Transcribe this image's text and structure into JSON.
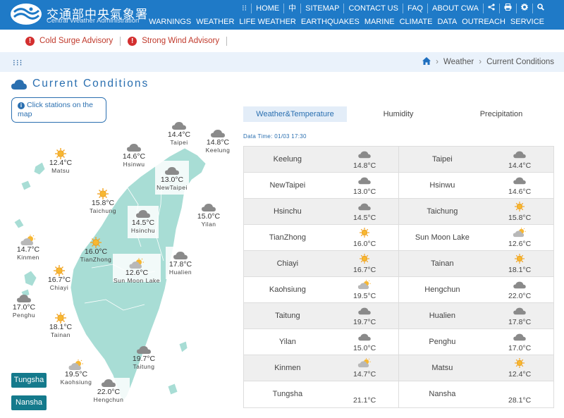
{
  "header": {
    "brand_zh": "交通部中央氣象署",
    "brand_en": "Central Weather Administration",
    "top_links": [
      "HOME",
      "中",
      "SITEMAP",
      "CONTACT US",
      "FAQ",
      "ABOUT CWA"
    ],
    "main_nav": [
      "WARNINGS",
      "WEATHER",
      "LIFE WEATHER",
      "EARTHQUAKES",
      "MARINE",
      "CLIMATE",
      "DATA",
      "OUTREACH",
      "SERVICE"
    ]
  },
  "advisories": [
    "Cold Surge Advisory",
    "Strong Wind Advisory"
  ],
  "breadcrumb": {
    "sep": "›",
    "level1": "Weather",
    "level2": "Current Conditions"
  },
  "page_title": "Current Conditions",
  "map_hint": "Click stations on the map",
  "map_stations": [
    {
      "name": "Taipei",
      "temp": "14.4°C",
      "icon": "cloudy-icon"
    },
    {
      "name": "Keelung",
      "temp": "14.8°C",
      "icon": "cloudy-icon"
    },
    {
      "name": "Hsinwu",
      "temp": "14.6°C",
      "icon": "cloudy-icon"
    },
    {
      "name": "Matsu",
      "temp": "12.4°C",
      "icon": "sunny-icon"
    },
    {
      "name": "NewTaipei",
      "temp": "13.0°C",
      "icon": "cloudy-icon"
    },
    {
      "name": "Taichung",
      "temp": "15.8°C",
      "icon": "sunny-icon"
    },
    {
      "name": "Hsinchu",
      "temp": "14.5°C",
      "icon": "cloudy-icon"
    },
    {
      "name": "Yilan",
      "temp": "15.0°C",
      "icon": "cloudy-icon"
    },
    {
      "name": "Kinmen",
      "temp": "14.7°C",
      "icon": "partly-cloudy-icon"
    },
    {
      "name": "TianZhong",
      "temp": "16.0°C",
      "icon": "sunny-icon"
    },
    {
      "name": "Sun Moon Lake",
      "temp": "12.6°C",
      "icon": "partly-cloudy-icon"
    },
    {
      "name": "Hualien",
      "temp": "17.8°C",
      "icon": "cloudy-icon"
    },
    {
      "name": "Chiayi",
      "temp": "16.7°C",
      "icon": "sunny-icon"
    },
    {
      "name": "Penghu",
      "temp": "17.0°C",
      "icon": "cloudy-icon"
    },
    {
      "name": "Tainan",
      "temp": "18.1°C",
      "icon": "sunny-icon"
    },
    {
      "name": "Taitung",
      "temp": "19.7°C",
      "icon": "cloudy-icon"
    },
    {
      "name": "Kaohsiung",
      "temp": "19.5°C",
      "icon": "partly-cloudy-icon"
    },
    {
      "name": "Hengchun",
      "temp": "22.0°C",
      "icon": "cloudy-icon"
    }
  ],
  "island_buttons": [
    "Tungsha",
    "Nansha"
  ],
  "tabs": [
    "Weather&Temperature",
    "Humidity",
    "Precipitation"
  ],
  "data_time": "Data Time: 01/03 17:30",
  "table_rows": [
    {
      "left": {
        "name": "Keelung",
        "temp": "14.8°C",
        "icon": "cloudy-icon"
      },
      "right": {
        "name": "Taipei",
        "temp": "14.4°C",
        "icon": "cloudy-icon"
      }
    },
    {
      "left": {
        "name": "NewTaipei",
        "temp": "13.0°C",
        "icon": "cloudy-icon"
      },
      "right": {
        "name": "Hsinwu",
        "temp": "14.6°C",
        "icon": "cloudy-icon"
      }
    },
    {
      "left": {
        "name": "Hsinchu",
        "temp": "14.5°C",
        "icon": "cloudy-icon"
      },
      "right": {
        "name": "Taichung",
        "temp": "15.8°C",
        "icon": "sunny-icon"
      }
    },
    {
      "left": {
        "name": "TianZhong",
        "temp": "16.0°C",
        "icon": "sunny-icon"
      },
      "right": {
        "name": "Sun Moon Lake",
        "temp": "12.6°C",
        "icon": "partly-cloudy-icon"
      }
    },
    {
      "left": {
        "name": "Chiayi",
        "temp": "16.7°C",
        "icon": "sunny-icon"
      },
      "right": {
        "name": "Tainan",
        "temp": "18.1°C",
        "icon": "sunny-icon"
      }
    },
    {
      "left": {
        "name": "Kaohsiung",
        "temp": "19.5°C",
        "icon": "partly-cloudy-icon"
      },
      "right": {
        "name": "Hengchun",
        "temp": "22.0°C",
        "icon": "cloudy-icon"
      }
    },
    {
      "left": {
        "name": "Taitung",
        "temp": "19.7°C",
        "icon": "cloudy-icon"
      },
      "right": {
        "name": "Hualien",
        "temp": "17.8°C",
        "icon": "cloudy-icon"
      }
    },
    {
      "left": {
        "name": "Yilan",
        "temp": "15.0°C",
        "icon": "cloudy-icon"
      },
      "right": {
        "name": "Penghu",
        "temp": "17.0°C",
        "icon": "cloudy-icon"
      }
    },
    {
      "left": {
        "name": "Kinmen",
        "temp": "14.7°C",
        "icon": "partly-cloudy-icon"
      },
      "right": {
        "name": "Matsu",
        "temp": "12.4°C",
        "icon": "sunny-icon"
      }
    },
    {
      "left": {
        "name": "Tungsha",
        "temp": "21.1°C",
        "icon": ""
      },
      "right": {
        "name": "Nansha",
        "temp": "28.1°C",
        "icon": ""
      }
    }
  ],
  "colors": {
    "header": "#1f7ac7",
    "island": "#a8ddd5",
    "accent": "#2a6fb0",
    "advisory": "#c0392b"
  }
}
